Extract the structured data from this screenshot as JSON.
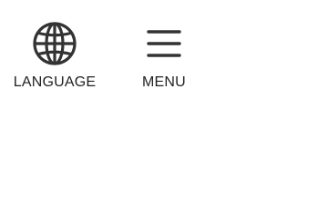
{
  "nav": {
    "language": {
      "label": "LANGUAGE",
      "icon": "globe-icon"
    },
    "menu": {
      "label": "MENU",
      "icon": "hamburger-menu-icon"
    }
  },
  "colors": {
    "icon": "#333333",
    "text": "#222222",
    "background": "#ffffff"
  }
}
